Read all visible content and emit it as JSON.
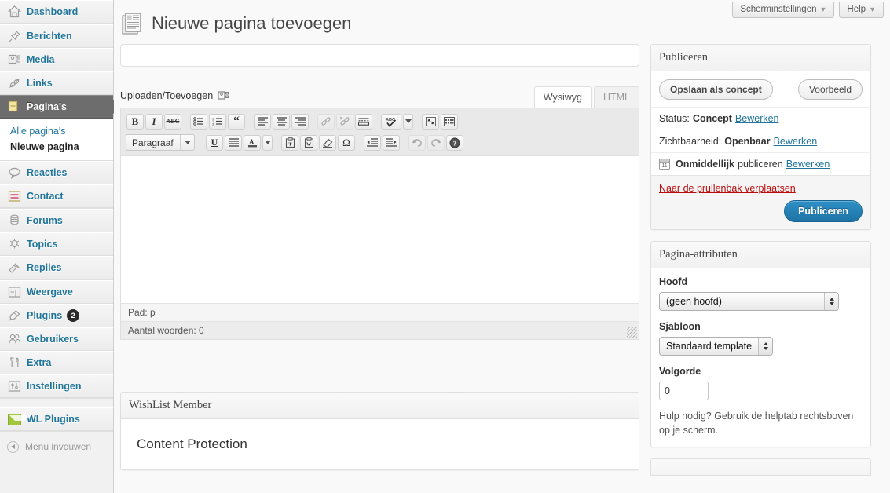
{
  "sidebar": {
    "groups": [
      {
        "items": [
          {
            "label": "Dashboard",
            "icon": "dashboard-icon",
            "current": false
          }
        ]
      },
      {
        "items": [
          {
            "label": "Berichten",
            "icon": "pin-icon",
            "current": false
          },
          {
            "label": "Media",
            "icon": "media-icon",
            "current": false
          },
          {
            "label": "Links",
            "icon": "link-icon",
            "current": false
          },
          {
            "label": "Pagina's",
            "icon": "pages-icon",
            "current": true
          }
        ]
      },
      {
        "items": [
          {
            "label": "Reacties",
            "icon": "comment-icon",
            "current": false
          },
          {
            "label": "Contact",
            "icon": "contact-icon",
            "current": false
          }
        ]
      },
      {
        "items": [
          {
            "label": "Forums",
            "icon": "forums-icon",
            "current": false
          },
          {
            "label": "Topics",
            "icon": "topics-icon",
            "current": false
          },
          {
            "label": "Replies",
            "icon": "replies-icon",
            "current": false
          }
        ]
      },
      {
        "items": [
          {
            "label": "Weergave",
            "icon": "appearance-icon",
            "current": false
          },
          {
            "label": "Plugins",
            "icon": "plugin-icon",
            "current": false,
            "badge": "2"
          },
          {
            "label": "Gebruikers",
            "icon": "users-icon",
            "current": false
          },
          {
            "label": "Extra",
            "icon": "tools-icon",
            "current": false
          },
          {
            "label": "Instellingen",
            "icon": "settings-icon",
            "current": false
          }
        ]
      },
      {
        "items": [
          {
            "label": "WL Plugins",
            "icon": "wl-plugins-icon",
            "current": false
          }
        ]
      }
    ],
    "submenu": [
      {
        "label": "Alle pagina's",
        "active": false
      },
      {
        "label": "Nieuwe pagina",
        "active": true
      }
    ],
    "collapse_label": "Menu invouwen"
  },
  "screen_meta": {
    "screen_options": "Scherminstellingen",
    "help": "Help",
    "caret": "▼"
  },
  "header": {
    "title": "Nieuwe pagina toevoegen",
    "icon": "page-document-icon"
  },
  "editor": {
    "title_value": "",
    "title_placeholder": "",
    "media_label": "Uploaden/Toevoegen",
    "media_icon": "add-media-icon",
    "tabs": [
      {
        "label": "Wysiwyg",
        "active": true
      },
      {
        "label": "HTML",
        "active": false
      }
    ],
    "toolbar_row1": [
      {
        "name": "bold-icon",
        "glyph": "B",
        "style": "bold-serif"
      },
      {
        "name": "italic-icon",
        "glyph": "I",
        "style": "italic-serif"
      },
      {
        "name": "strikethrough-icon",
        "glyph": "ABC",
        "style": "strike"
      },
      {
        "name": "unordered-list-icon",
        "glyph": "",
        "style": "ul"
      },
      {
        "name": "ordered-list-icon",
        "glyph": "",
        "style": "ol"
      },
      {
        "name": "blockquote-icon",
        "glyph": "“",
        "style": "quote"
      },
      {
        "name": "align-left-icon",
        "glyph": "",
        "style": "align-left"
      },
      {
        "name": "align-center-icon",
        "glyph": "",
        "style": "align-center"
      },
      {
        "name": "align-right-icon",
        "glyph": "",
        "style": "align-right"
      },
      {
        "name": "insert-link-icon",
        "glyph": "",
        "style": "link",
        "disabled": true
      },
      {
        "name": "unlink-icon",
        "glyph": "",
        "style": "unlink",
        "disabled": true
      },
      {
        "name": "more-tag-icon",
        "glyph": "",
        "style": "more"
      },
      {
        "name": "spellcheck-icon",
        "glyph": "ABC",
        "style": "spell"
      },
      {
        "name": "fullscreen-icon",
        "glyph": "",
        "style": "fullscreen"
      },
      {
        "name": "kitchen-sink-icon",
        "glyph": "",
        "style": "sink"
      }
    ],
    "format_select": "Paragraaf",
    "toolbar_row2": [
      {
        "name": "underline-icon",
        "glyph": "U",
        "style": "underline"
      },
      {
        "name": "align-justify-icon",
        "glyph": "",
        "style": "justify"
      },
      {
        "name": "text-color-icon",
        "glyph": "A",
        "style": "textcolor"
      },
      {
        "name": "paste-as-text-icon",
        "glyph": "T",
        "style": "paste-t"
      },
      {
        "name": "paste-from-word-icon",
        "glyph": "W",
        "style": "paste-w"
      },
      {
        "name": "remove-formatting-icon",
        "glyph": "",
        "style": "eraser"
      },
      {
        "name": "special-character-icon",
        "glyph": "Ω",
        "style": "omega"
      },
      {
        "name": "outdent-icon",
        "glyph": "",
        "style": "outdent"
      },
      {
        "name": "indent-icon",
        "glyph": "",
        "style": "indent"
      },
      {
        "name": "undo-icon",
        "glyph": "",
        "style": "undo",
        "disabled": true
      },
      {
        "name": "redo-icon",
        "glyph": "",
        "style": "redo",
        "disabled": true
      },
      {
        "name": "help-icon",
        "glyph": "?",
        "style": "help"
      }
    ],
    "content": "",
    "path_status": "Pad: p",
    "word_count": "Aantal woorden: 0"
  },
  "publish": {
    "title": "Publiceren",
    "save_draft": "Opslaan als concept",
    "preview": "Voorbeeld",
    "status_label": "Status:",
    "status_value": "Concept",
    "status_edit": "Bewerken",
    "visibility_label": "Zichtbaarheid:",
    "visibility_value": "Openbaar",
    "visibility_edit": "Bewerken",
    "schedule_value": "Onmiddellijk",
    "schedule_label": "publiceren",
    "schedule_edit": "Bewerken",
    "trash": "Naar de prullenbak verplaatsen",
    "publish_button": "Publiceren"
  },
  "attributes": {
    "title": "Pagina-attributen",
    "parent_label": "Hoofd",
    "parent_value": "(geen hoofd)",
    "template_label": "Sjabloon",
    "template_value": "Standaard template",
    "order_label": "Volgorde",
    "order_value": "0",
    "help_text": "Hulp nodig? Gebruik de helptab rechtsboven op je scherm."
  },
  "wishlist": {
    "title": "WishList Member",
    "heading": "Content Protection"
  },
  "colors": {
    "link": "#21759b",
    "trash": "#bc0b0b",
    "publish_button": "#2e8fc4",
    "current_menu_bg": "#6d6d6d",
    "wl_green": "#a4c63f"
  }
}
